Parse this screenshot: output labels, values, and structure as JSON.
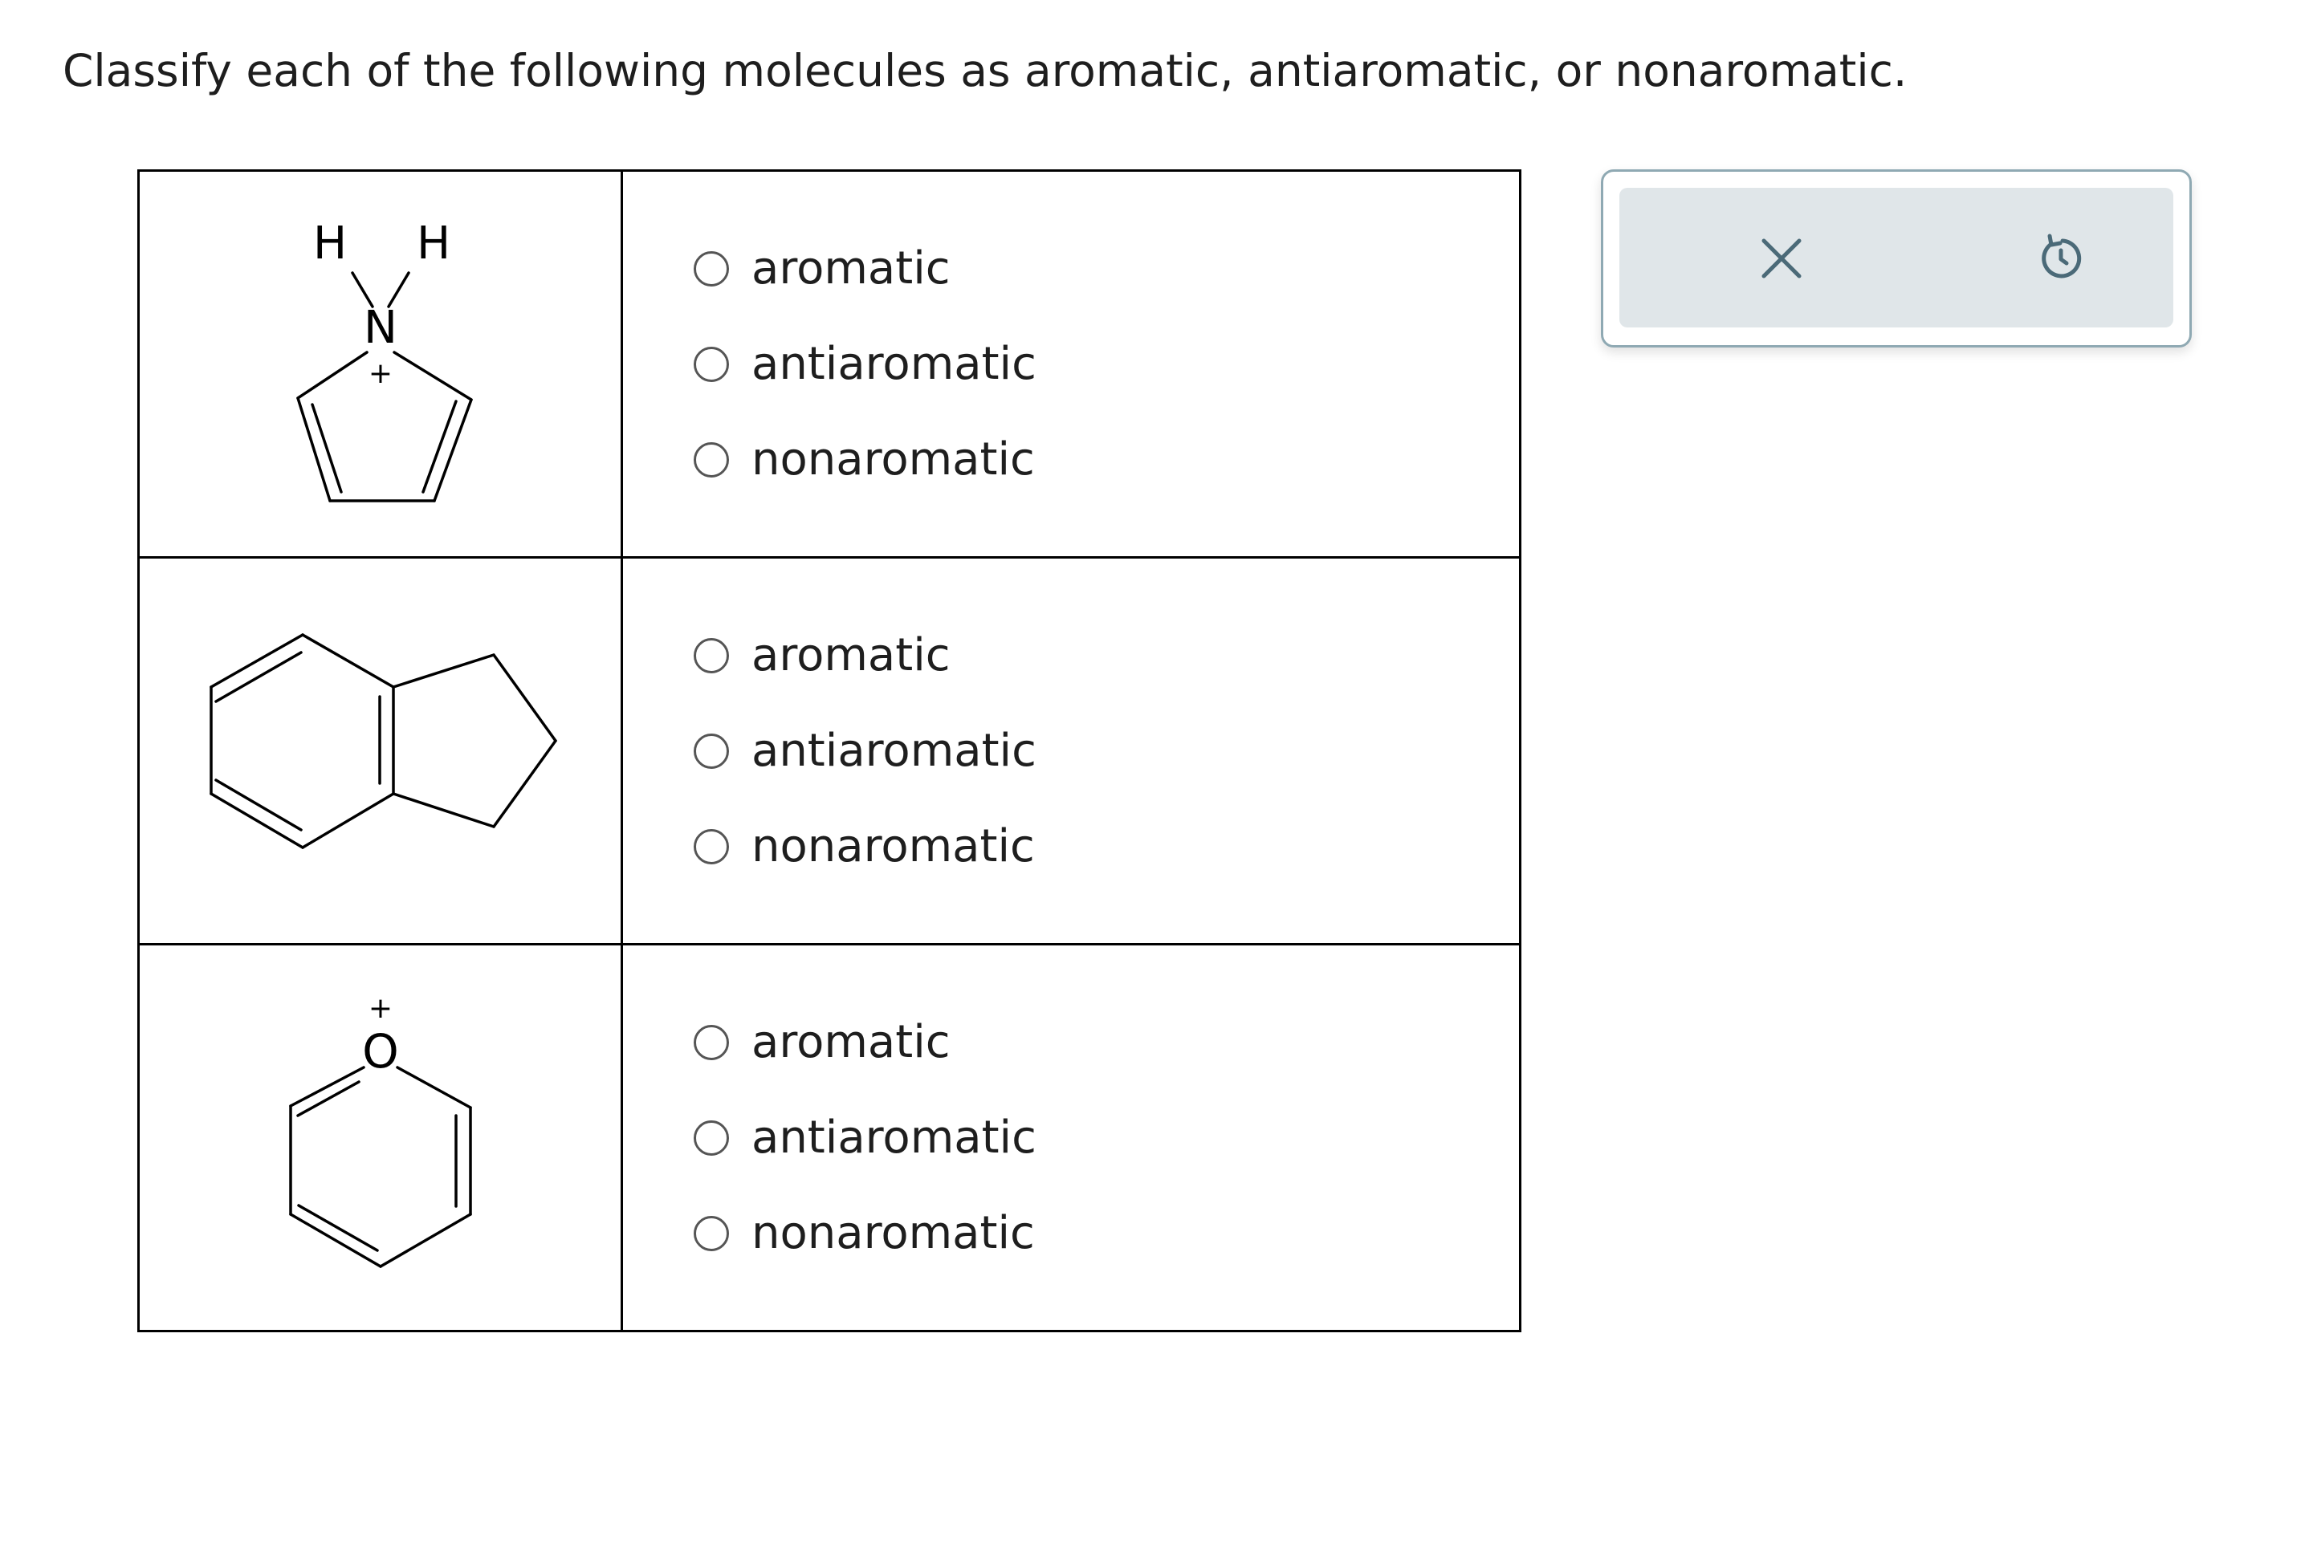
{
  "question": {
    "text": "Classify each of the following molecules as aromatic, antiaromatic, or nonaromatic."
  },
  "rows": [
    {
      "molecule": {
        "atom_labels": {
          "h_left": "H",
          "h_right": "H",
          "heteroatom": "N",
          "charge": "+"
        }
      },
      "options": [
        "aromatic",
        "antiaromatic",
        "nonaromatic"
      ],
      "selected": null
    },
    {
      "molecule": {
        "atom_labels": {}
      },
      "options": [
        "aromatic",
        "antiaromatic",
        "nonaromatic"
      ],
      "selected": null
    },
    {
      "molecule": {
        "atom_labels": {
          "heteroatom": "O",
          "charge": "+"
        }
      },
      "options": [
        "aromatic",
        "antiaromatic",
        "nonaromatic"
      ],
      "selected": null
    }
  ],
  "toolbar": {
    "clear_icon": "close-icon",
    "reset_icon": "undo-icon"
  },
  "colors": {
    "toolbar_border": "#8fa9b3",
    "toolbar_fill": "#e0e6e9",
    "icon": "#4b6a78"
  }
}
